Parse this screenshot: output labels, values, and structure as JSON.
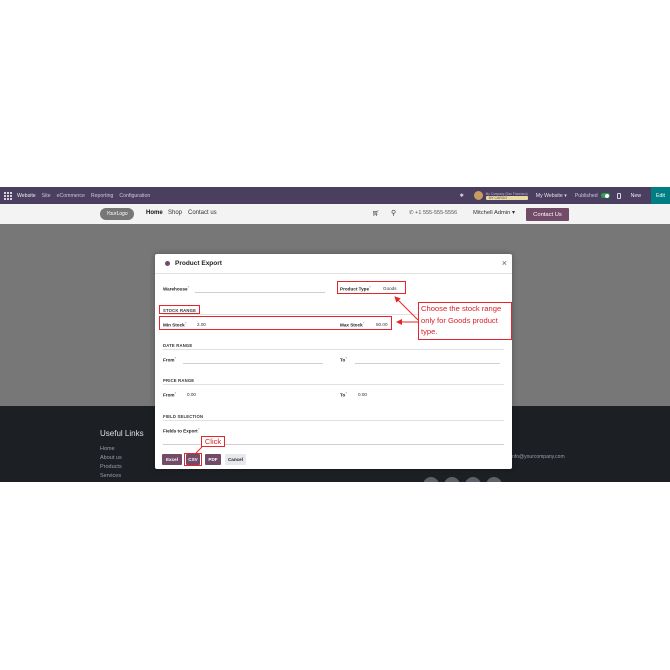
{
  "topbar": {
    "brand": "Website",
    "menu": [
      "Site",
      "eCommerce",
      "Reporting",
      "Configuration"
    ],
    "company_line1": "My Company (San Francisco)",
    "company_badge": "MY CARGO",
    "my_website": "My Website",
    "published": "Published",
    "new": "New",
    "edit": "Edit"
  },
  "header": {
    "logo": "YourLogo",
    "nav": [
      "Home",
      "Shop",
      "Contact us"
    ],
    "phone": "+1 555-555-5556",
    "user": "Mitchell Admin",
    "contact_button": "Contact Us"
  },
  "modal": {
    "title": "Product Export",
    "warehouse_label": "Warehouse",
    "product_type_label": "Product Type",
    "product_type_value": "Goods",
    "stock_range": {
      "section": "STOCK RANGE",
      "min_label": "Min Stock",
      "min_value": "2.00",
      "max_label": "Max Stock",
      "max_value": "50.00"
    },
    "date_range": {
      "section": "DATE RANGE",
      "from_label": "From",
      "to_label": "To"
    },
    "price_range": {
      "section": "PRICE RANGE",
      "from_label": "From",
      "from_value": "0.00",
      "to_label": "To",
      "to_value": "0.00"
    },
    "field_selection": {
      "section": "FIELD SELECTION",
      "fields_label": "Fields to Export"
    },
    "buttons": {
      "excel": "Excel",
      "csv": "CSV",
      "pdf": "PDF",
      "cancel": "Cancel"
    },
    "help_mark": "?"
  },
  "footer": {
    "useful_links": "Useful Links",
    "links": [
      "Home",
      "About us",
      "Products",
      "Services"
    ],
    "email": "info@yourcompany.com"
  },
  "annotations": {
    "callout": "Choose the stock range only for Goods product type.",
    "click": "Click"
  },
  "colors": {
    "admin_bar": "#4a3f5f",
    "primary": "#714b67",
    "edit": "#017e84",
    "annotation": "#e4262c"
  }
}
